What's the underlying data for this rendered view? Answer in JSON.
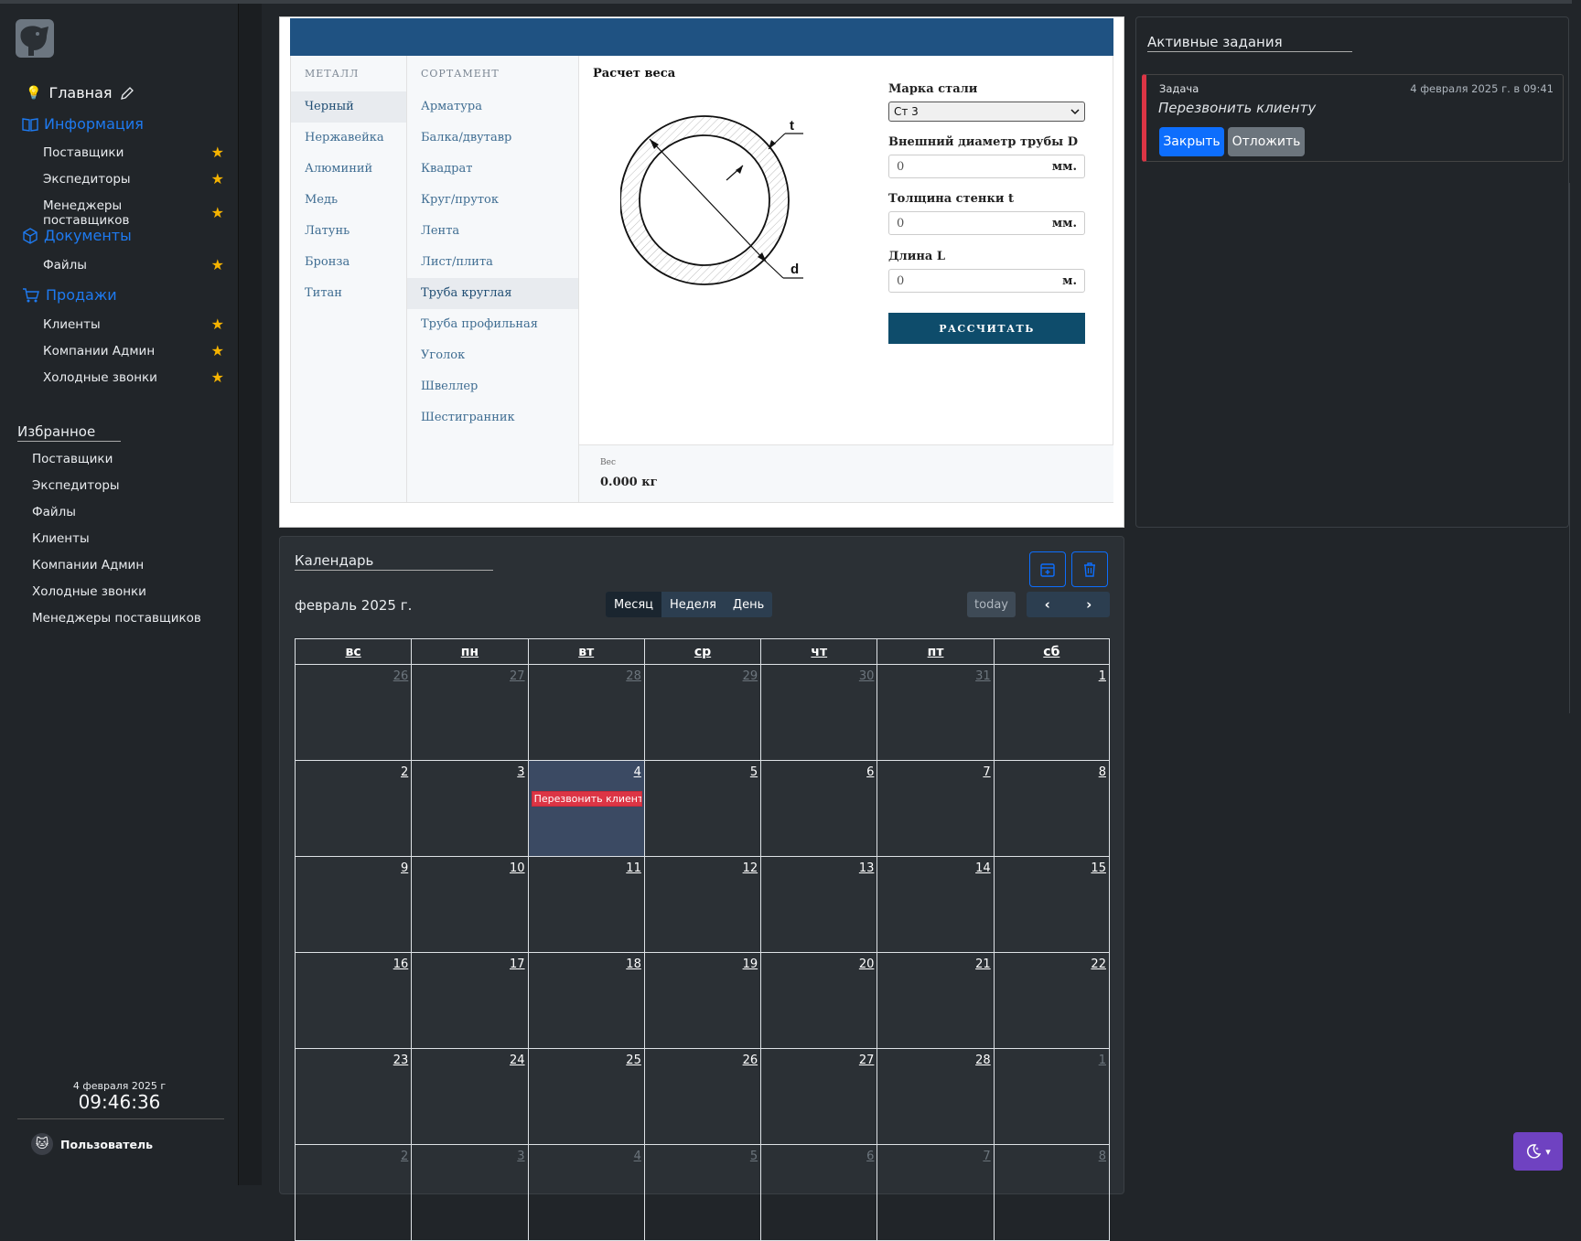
{
  "sidebar": {
    "home_label": "Главная",
    "sections": [
      {
        "label": "Информация",
        "items": [
          "Поставщики",
          "Экспедиторы",
          "Менеджеры поставщиков"
        ]
      },
      {
        "label": "Документы",
        "items": [
          "Файлы"
        ]
      },
      {
        "label": "Продажи",
        "items": [
          "Клиенты",
          "Компании Админ",
          "Холодные звонки"
        ]
      }
    ],
    "favorites_title": "Избранное",
    "favorites": [
      "Поставщики",
      "Экспедиторы",
      "Файлы",
      "Клиенты",
      "Компании Админ",
      "Холодные звонки",
      "Менеджеры поставщиков"
    ],
    "clock_date": "4 февраля 2025 г",
    "clock_time": "09:46:36",
    "user_name": "Пользователь"
  },
  "calculator": {
    "metal_header": "МЕТАЛЛ",
    "metals": [
      "Черный",
      "Нержавейка",
      "Алюминий",
      "Медь",
      "Латунь",
      "Бронза",
      "Титан"
    ],
    "active_metal": "Черный",
    "assortment_header": "СОРТАМЕНТ",
    "assortment": [
      "Арматура",
      "Балка/двутавр",
      "Квадрат",
      "Круг/пруток",
      "Лента",
      "Лист/плита",
      "Труба круглая",
      "Труба профильная",
      "Уголок",
      "Швеллер",
      "Шестигранник"
    ],
    "active_assortment": "Труба круглая",
    "title": "Расчет веса",
    "diagram_labels": {
      "t": "t",
      "d": "d"
    },
    "steel_grade_label": "Марка стали",
    "steel_grade_value": "Ст 3",
    "outer_diameter_label": "Внешний диаметр трубы D",
    "outer_diameter_value": "0",
    "outer_diameter_unit": "мм.",
    "wall_thickness_label": "Толщина стенки t",
    "wall_thickness_value": "0",
    "wall_thickness_unit": "мм.",
    "length_label": "Длина L",
    "length_value": "0",
    "length_unit": "м.",
    "calculate_label": "РАССЧИТАТЬ",
    "weight_label": "Вес",
    "weight_value": "0.000 кг",
    "header_color": "#1f5282"
  },
  "tasks": {
    "title": "Активные задания",
    "items": [
      {
        "label": "Задача",
        "date": "4 февраля 2025 г. в 09:41",
        "text": "Перезвонить клиенту",
        "close_label": "Закрыть",
        "postpone_label": "Отложить"
      }
    ]
  },
  "calendar": {
    "title": "Календарь",
    "month_label": "февраль 2025 г.",
    "views": [
      "Месяц",
      "Неделя",
      "День"
    ],
    "active_view": "Месяц",
    "today_label": "today",
    "weekdays": [
      "вс",
      "пн",
      "вт",
      "ср",
      "чт",
      "пт",
      "сб"
    ],
    "weeks": [
      [
        "26",
        "27",
        "28",
        "29",
        "30",
        "31",
        "1"
      ],
      [
        "2",
        "3",
        "4",
        "5",
        "6",
        "7",
        "8"
      ],
      [
        "9",
        "10",
        "11",
        "12",
        "13",
        "14",
        "15"
      ],
      [
        "16",
        "17",
        "18",
        "19",
        "20",
        "21",
        "22"
      ],
      [
        "23",
        "24",
        "25",
        "26",
        "27",
        "28",
        "1"
      ],
      [
        "2",
        "3",
        "4",
        "5",
        "6",
        "7",
        "8"
      ]
    ],
    "other_month": [
      [
        true,
        true,
        true,
        true,
        true,
        true,
        false
      ],
      [
        false,
        false,
        false,
        false,
        false,
        false,
        false
      ],
      [
        false,
        false,
        false,
        false,
        false,
        false,
        false
      ],
      [
        false,
        false,
        false,
        false,
        false,
        false,
        false
      ],
      [
        false,
        false,
        false,
        false,
        false,
        false,
        true
      ],
      [
        true,
        true,
        true,
        true,
        true,
        true,
        true
      ]
    ],
    "today": {
      "week": 1,
      "day": 2
    },
    "events": [
      {
        "week": 1,
        "day": 2,
        "title": "Перезвонить клиенту",
        "color": "#dc3545"
      }
    ]
  },
  "theme": {
    "accent": "#6f42c1",
    "link": "#1e7af0",
    "star": "#f5b301"
  }
}
